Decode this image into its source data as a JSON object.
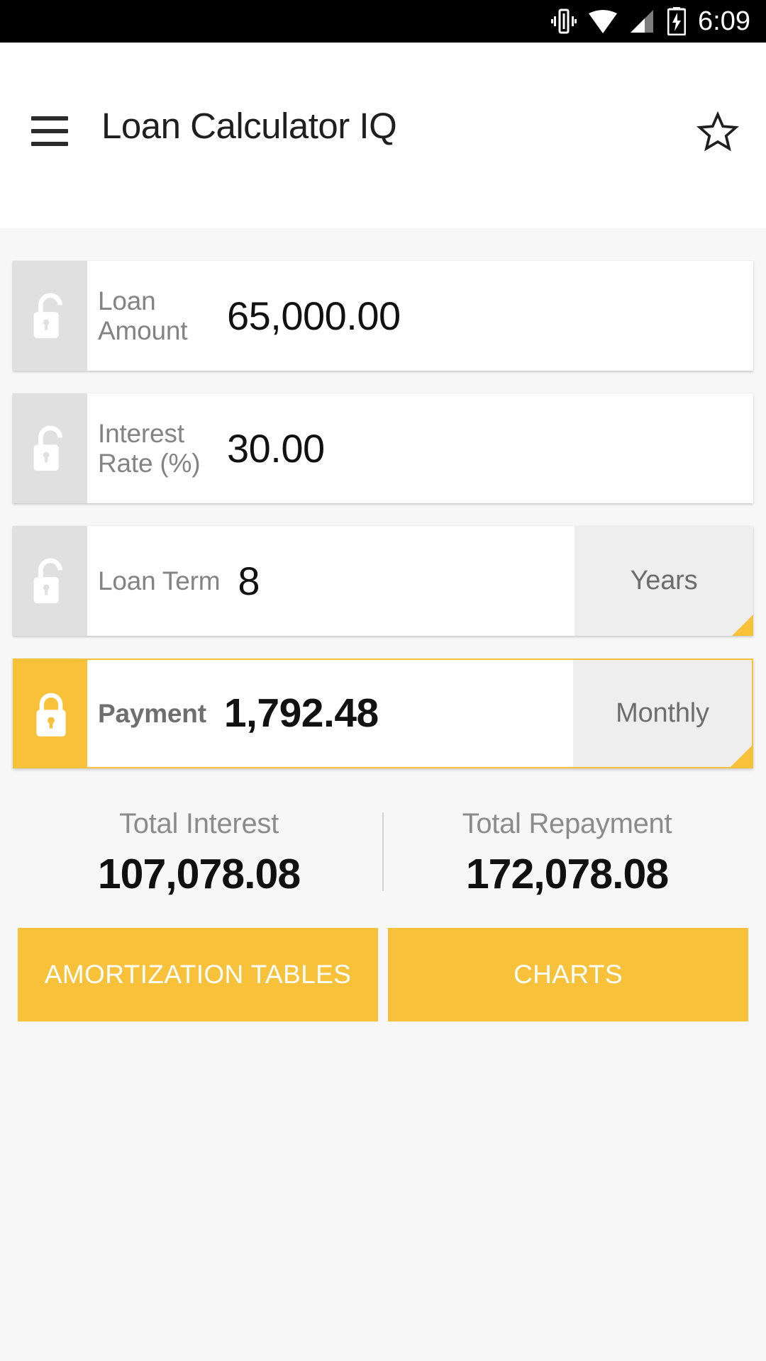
{
  "status_bar": {
    "time": "6:09",
    "icons": [
      "vibrate-icon",
      "wifi-icon",
      "cellular-signal-icon",
      "battery-charging-icon"
    ]
  },
  "app_bar": {
    "menu_icon": "hamburger-menu-icon",
    "title": "Loan Calculator IQ",
    "favorite_icon": "star-outline-icon"
  },
  "colors": {
    "accent": "#f8c13a",
    "lock_inactive_bg": "#e0e0e0",
    "unit_bg": "#eeeeee",
    "content_bg": "#f7f7f7",
    "label_gray": "#838383"
  },
  "fields": [
    {
      "name": "loan-amount",
      "label": "Loan Amount",
      "value": "65,000.00",
      "locked": false,
      "lock_icon": "unlock-icon",
      "has_unit": false,
      "unit": null
    },
    {
      "name": "interest-rate",
      "label": "Interest Rate (%)",
      "value": "30.00",
      "locked": false,
      "lock_icon": "unlock-icon",
      "has_unit": false,
      "unit": null
    },
    {
      "name": "loan-term",
      "label": "Loan Term",
      "value": "8",
      "locked": false,
      "lock_icon": "unlock-icon",
      "has_unit": true,
      "unit": "Years"
    },
    {
      "name": "payment",
      "label": "Payment",
      "value": "1,792.48",
      "locked": true,
      "lock_icon": "lock-closed-icon",
      "has_unit": true,
      "unit": "Monthly"
    }
  ],
  "totals": {
    "interest_label": "Total Interest",
    "interest_value": "107,078.08",
    "repayment_label": "Total Repayment",
    "repayment_value": "172,078.08"
  },
  "actions": {
    "amortization_label": "AMORTIZATION TABLES",
    "charts_label": "CHARTS"
  }
}
